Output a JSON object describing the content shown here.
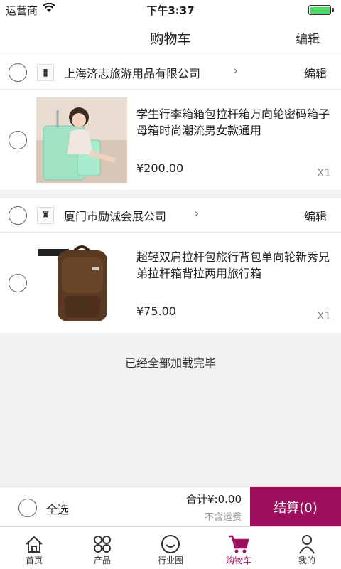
{
  "status_bar": {
    "carrier": "运营商",
    "time": "下午3:37"
  },
  "nav": {
    "title": "购物车",
    "edit_label": "编辑"
  },
  "shops": [
    {
      "name": "上海济志旅游用品有限公司",
      "edit_label": "编辑",
      "item": {
        "title": "学生行李箱箱包拉杆箱万向轮密码箱子母箱时尚潮流男女款通用",
        "price": "¥200.00",
        "qty": "X1"
      }
    },
    {
      "name": "厦门市励诚会展公司",
      "edit_label": "编辑",
      "item": {
        "title": "超轻双肩拉杆包旅行背包单向轮新秀兄弟拉杆箱背拉两用旅行箱",
        "price": "¥75.00",
        "qty": "X1"
      }
    }
  ],
  "footer_text": "已经全部加载完毕",
  "checkout": {
    "select_all": "全选",
    "total": "合计¥:0.00",
    "shipping": "不含运费",
    "button": "结算(0)"
  },
  "tabs": [
    {
      "label": "首页",
      "icon": "home-icon"
    },
    {
      "label": "产品",
      "icon": "grid-icon"
    },
    {
      "label": "行业圈",
      "icon": "smile-icon"
    },
    {
      "label": "购物车",
      "icon": "cart-icon",
      "active": true
    },
    {
      "label": "我的",
      "icon": "person-icon"
    }
  ],
  "colors": {
    "accent": "#9b0f5d",
    "battery": "#4cd964"
  }
}
